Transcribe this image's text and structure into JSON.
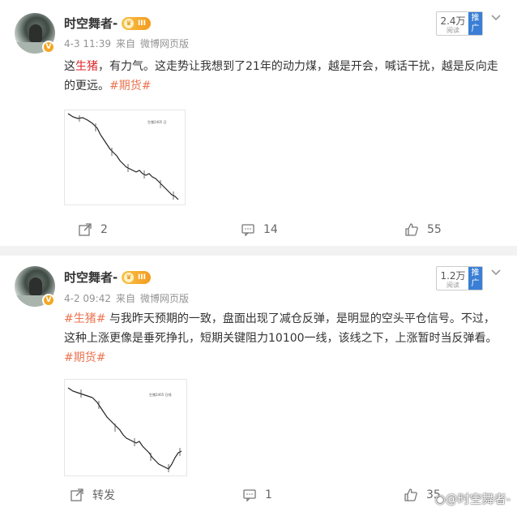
{
  "posts": [
    {
      "username": "时空舞者-",
      "level_badge": "III",
      "date": "4-3 11:39",
      "source_prefix": "来自",
      "source": "微博网页版",
      "views": "2.4万",
      "views_label": "阅读",
      "push_label": "推广",
      "text_parts": [
        "这",
        "生猪",
        "，有力气。这走势让我想到了21年的动力煤，越是开会，喊话干扰，越是反向走的更远。",
        "#期货#"
      ],
      "chart_label": "生猪2405 日",
      "repost": "2",
      "comments": "14",
      "likes": "55"
    },
    {
      "username": "时空舞者-",
      "level_badge": "III",
      "date": "4-2 09:42",
      "source_prefix": "来自",
      "source": "微博网页版",
      "views": "1.2万",
      "views_label": "阅读",
      "push_label": "推广",
      "text_parts": [
        "#生猪#",
        " 与我昨天预期的一致，盘面出现了减仓反弹，是明显的空头平仓信号。不过，这种上涨更像是垂死挣扎，短期关键阻力10100一线，该线之下，上涨暂时当反弹看。",
        "#期货#"
      ],
      "chart_label": "生猪2405 日线",
      "repost": "转发",
      "comments": "1",
      "likes": "35"
    }
  ],
  "watermark": "@时空舞者-",
  "colors": {
    "tag": "#eb7350",
    "highlight": "#e0262a",
    "push": "#3a7fd5",
    "badge": "#f5a623"
  },
  "icons": [
    "repost-icon",
    "comment-icon",
    "like-icon",
    "chevron-down-icon",
    "weibo-logo-icon"
  ]
}
